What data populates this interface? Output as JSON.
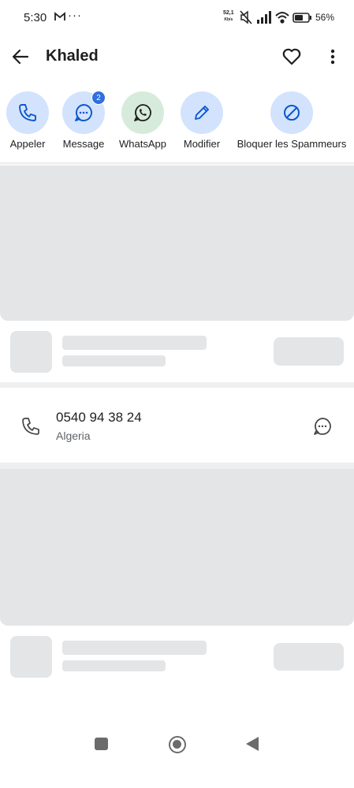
{
  "status_bar": {
    "time": "5:30",
    "overflow": "···",
    "net_speed_value": "52,1",
    "net_speed_unit": "Kb/s",
    "battery": "56%",
    "icons": [
      "gmail-icon",
      "mute-icon",
      "signal-icon",
      "wifi-icon",
      "battery-icon"
    ]
  },
  "app_bar": {
    "contact_name": "Khaled",
    "icons": [
      "back-arrow-icon",
      "heart-icon",
      "more-vert-icon"
    ]
  },
  "actions": [
    {
      "label": "Appeler",
      "icon": "phone-icon"
    },
    {
      "label": "Message",
      "icon": "chat-icon",
      "badge": "2"
    },
    {
      "label": "WhatsApp",
      "icon": "whatsapp-icon"
    },
    {
      "label": "Modifier",
      "icon": "pencil-icon"
    },
    {
      "label": "Bloquer les Spammeurs",
      "icon": "block-icon"
    }
  ],
  "phone_entry": {
    "number": "0540 94 38 24",
    "country": "Algeria"
  },
  "colors": {
    "action_circle": "#d3e3fd",
    "whatsapp_circle": "#d6ebdc",
    "icon_blue": "#0b57d0",
    "badge": "#2f6fe0",
    "placeholder": "#e4e5e7"
  }
}
